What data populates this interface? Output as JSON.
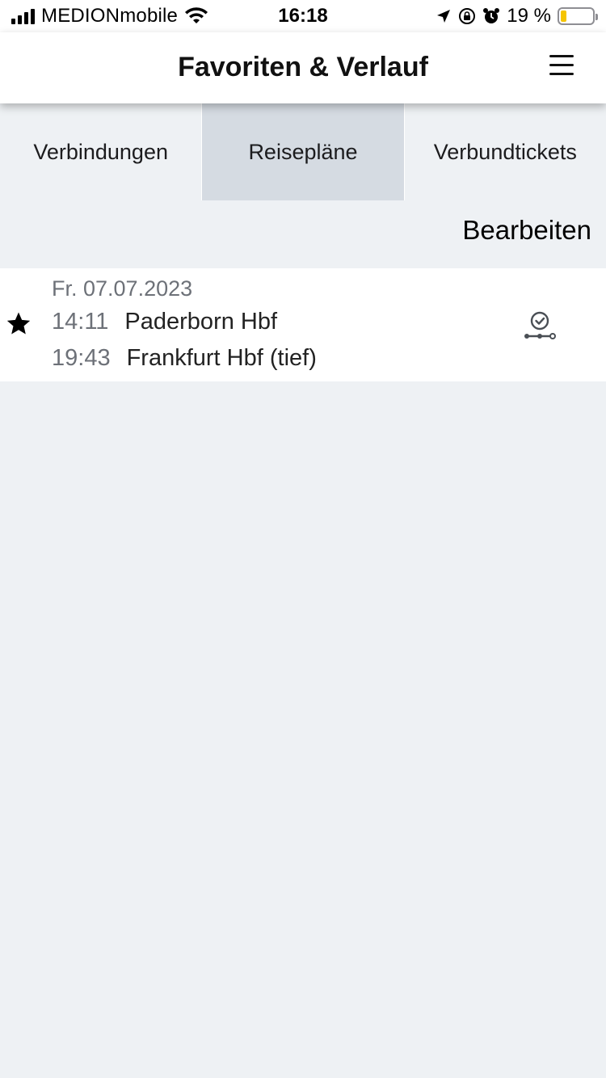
{
  "status_bar": {
    "carrier": "MEDIONmobile",
    "time": "16:18",
    "battery_text": "19 %",
    "battery_level": 0.19,
    "icons": [
      "signal-icon",
      "wifi-icon",
      "location-icon",
      "orientation-lock-icon",
      "alarm-icon",
      "battery-icon"
    ]
  },
  "header": {
    "title": "Favoriten & Verlauf",
    "menu_icon": "hamburger-menu-icon"
  },
  "tabs": [
    {
      "label": "Verbindungen",
      "active": false
    },
    {
      "label": "Reisepläne",
      "active": true
    },
    {
      "label": "Verbundtickets",
      "active": false
    }
  ],
  "toolbar": {
    "edit_label": "Bearbeiten"
  },
  "trips": [
    {
      "favorite": true,
      "date": "Fr. 07.07.2023",
      "departure_time": "14:11",
      "departure_station": "Paderborn Hbf",
      "arrival_time": "19:43",
      "arrival_station": "Frankfurt Hbf (tief)",
      "action_icon": "journey-timer-icon"
    }
  ],
  "colors": {
    "background": "#eef1f4",
    "active_tab": "#d5dbe2",
    "muted_text": "#6d7178",
    "battery": "#f5c400"
  }
}
